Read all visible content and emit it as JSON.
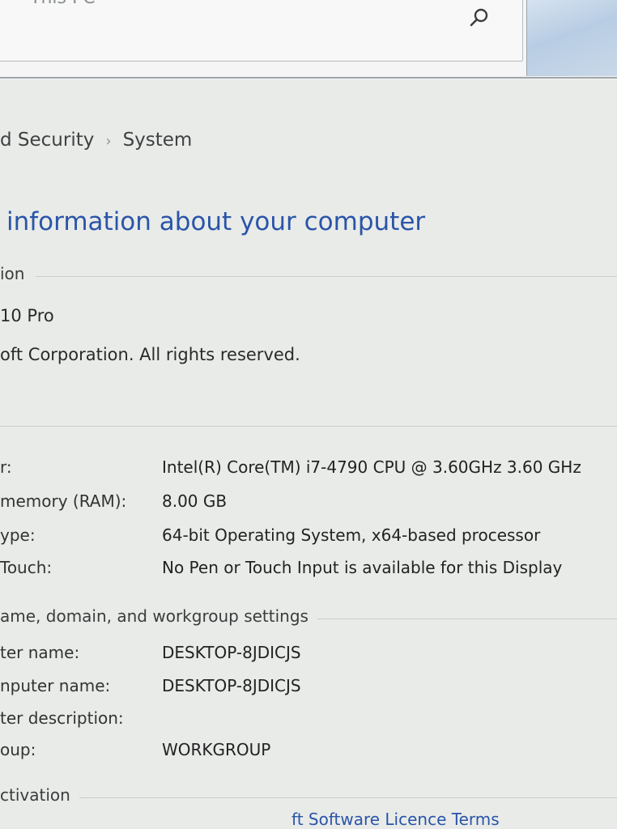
{
  "search": {
    "placeholder": "This PC"
  },
  "breadcrumb": {
    "parent": "d Security",
    "separator": "›",
    "current": "System"
  },
  "page": {
    "title": "information about your computer"
  },
  "edition": {
    "heading": "ion",
    "name": "10 Pro",
    "copyright": "oft Corporation. All rights reserved."
  },
  "system": {
    "rows": [
      {
        "label": "r:",
        "value": "Intel(R) Core(TM) i7-4790 CPU @ 3.60GHz   3.60 GHz"
      },
      {
        "label": "memory (RAM):",
        "value": "8.00 GB"
      },
      {
        "label": "ype:",
        "value": "64-bit Operating System, x64-based processor"
      },
      {
        "label": "Touch:",
        "value": "No Pen or Touch Input is available for this Display"
      }
    ]
  },
  "computer": {
    "heading": "ame, domain, and workgroup settings",
    "rows": [
      {
        "label": "ter name:",
        "value": "DESKTOP-8JDICJS"
      },
      {
        "label": "nputer name:",
        "value": "DESKTOP-8JDICJS"
      },
      {
        "label": "ter description:",
        "value": ""
      },
      {
        "label": "oup:",
        "value": "WORKGROUP"
      }
    ]
  },
  "activation": {
    "heading": "ctivation",
    "link": "ft Software Licence Terms"
  },
  "colors": {
    "title_blue": "#2a55a8",
    "background": "#e9ebe9"
  }
}
